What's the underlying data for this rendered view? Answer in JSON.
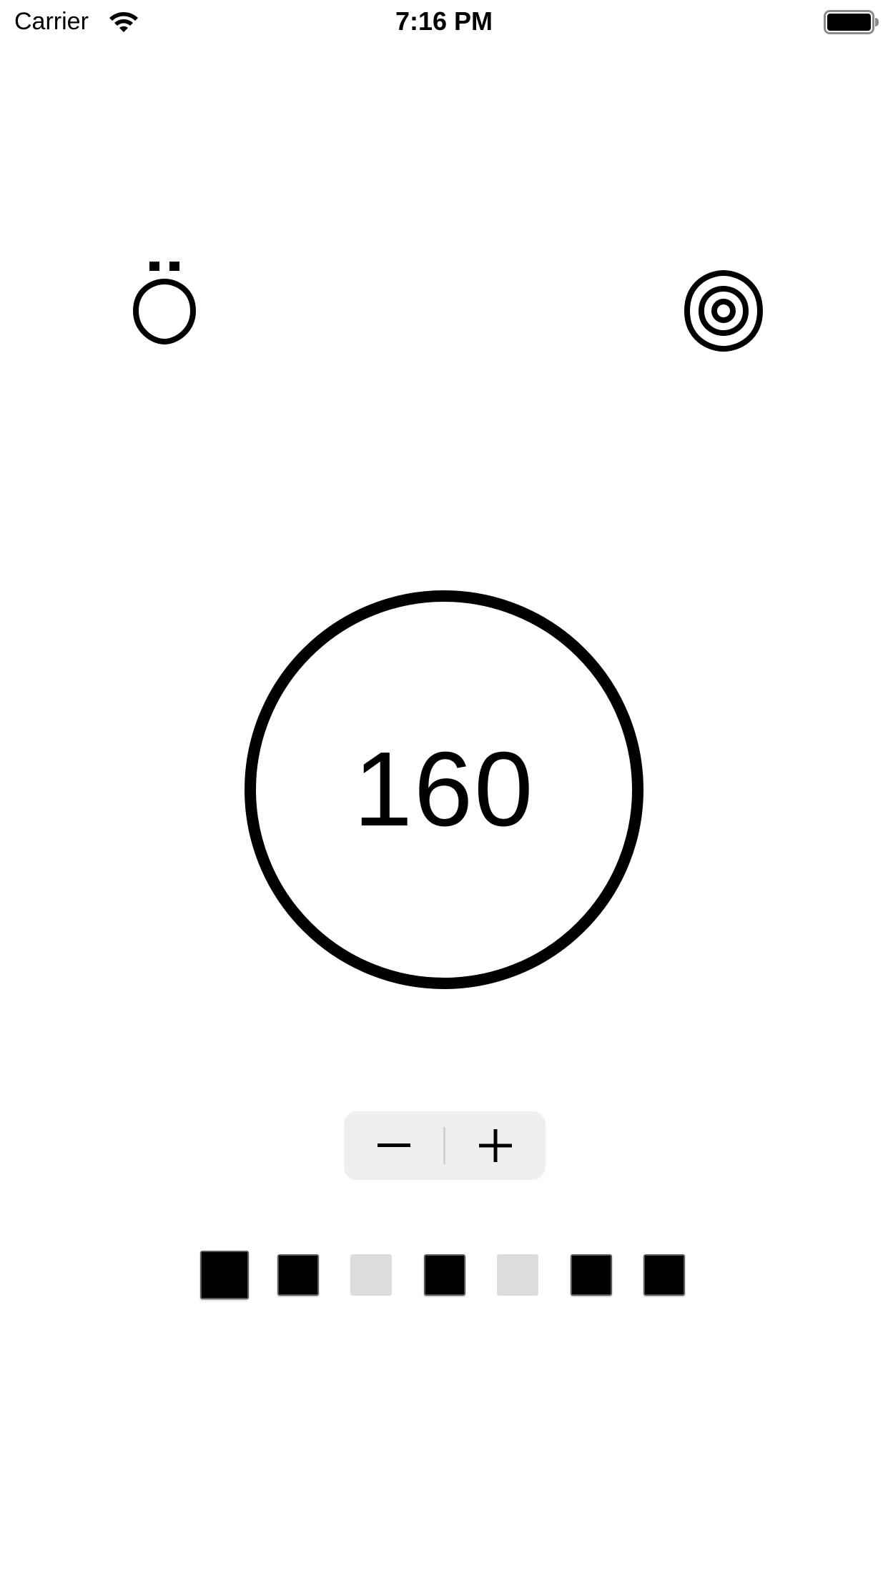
{
  "status_bar": {
    "carrier": "Carrier",
    "time": "7:16 PM",
    "icons": [
      "wifi-icon",
      "battery-icon"
    ]
  },
  "top_icons": {
    "left": "mascot-icon",
    "right": "target-icon"
  },
  "tempo": {
    "value": "160"
  },
  "stepper": {
    "decrement_icon": "minus-icon",
    "increment_icon": "plus-icon"
  },
  "beats": [
    {
      "state": "on",
      "accent": true
    },
    {
      "state": "on",
      "accent": false
    },
    {
      "state": "off",
      "accent": false
    },
    {
      "state": "on",
      "accent": false
    },
    {
      "state": "off",
      "accent": false
    },
    {
      "state": "on",
      "accent": false
    },
    {
      "state": "on",
      "accent": false
    }
  ],
  "colors": {
    "background": "#ffffff",
    "foreground": "#000000",
    "stepper_bg": "#efefef",
    "beat_off": "#dcdcdc"
  }
}
